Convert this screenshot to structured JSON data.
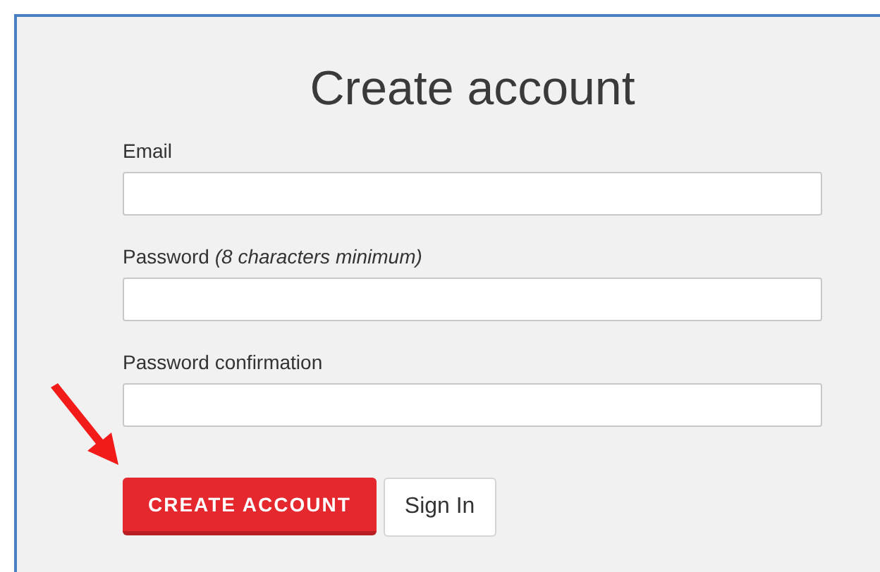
{
  "title": "Create account",
  "fields": [
    {
      "label": "Email"
    },
    {
      "label": "Password *(8 characters minimum)*"
    },
    {
      "label": "Password confirmation"
    }
  ],
  "buttons": [
    {
      "label": "CREATE ACCOUNT",
      "kind": "primary"
    },
    {
      "label": "Sign In",
      "kind": "secondary"
    }
  ]
}
